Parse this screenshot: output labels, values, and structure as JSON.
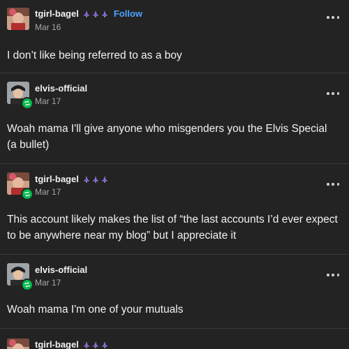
{
  "posts": [
    {
      "username": "tgirl-bagel",
      "badge_icons": [
        "witch-hat-icon",
        "witch-hat-icon",
        "witch-hat-icon"
      ],
      "follow_label": "Follow",
      "date": "Mar 16",
      "text": "I don’t like being referred to as a boy"
    },
    {
      "username": "elvis-official",
      "date": "Mar 17",
      "text": "Woah mama I'll give anyone who misgenders you the Elvis Special (a bullet)"
    },
    {
      "username": "tgirl-bagel",
      "badge_icons": [
        "witch-hat-icon",
        "witch-hat-icon",
        "witch-hat-icon"
      ],
      "date": "Mar 17",
      "text": "This account likely makes the list of “the last accounts I’d ever expect to be anywhere near my blog” but I appreciate it"
    },
    {
      "username": "elvis-official",
      "date": "Mar 17",
      "text": "Woah mama I'm one of your mutuals"
    },
    {
      "username": "tgirl-bagel",
      "badge_icons": [
        "witch-hat-icon",
        "witch-hat-icon",
        "witch-hat-icon"
      ]
    }
  ],
  "colors": {
    "background": "#232323",
    "follow": "#4fa3ff",
    "reblog_badge": "#00b84a"
  }
}
